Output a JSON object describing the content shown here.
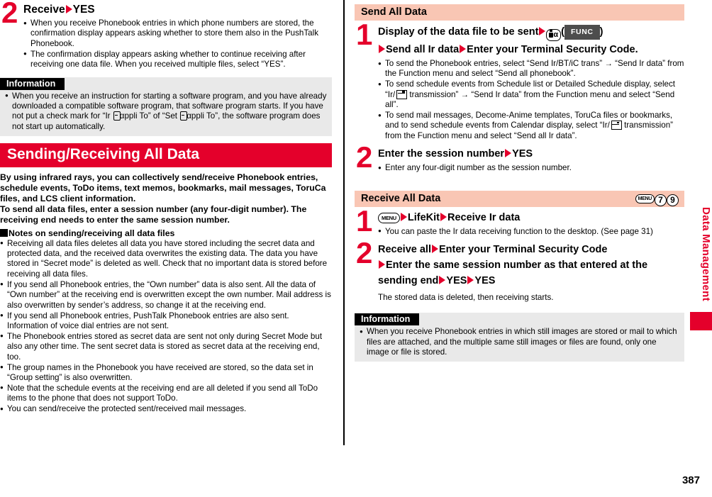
{
  "page": {
    "number": "387",
    "sidebar_label": "Data Management"
  },
  "left_column": {
    "step2": {
      "number": "2",
      "title_a": "Receive",
      "title_b": "YES",
      "bullets": [
        "When you receive Phonebook entries in which phone numbers are stored, the confirmation display appears asking whether to store them also in the PushTalk Phonebook.",
        "The confirmation display appears asking whether to continue receiving after receiving one data file. When you received multiple files, select “YES”."
      ]
    },
    "information": {
      "tag": "Information",
      "text_part1": "When you receive an instruction for starting a software program, and you have already downloaded a compatible software program, that software program starts. If you have not put a check mark for “Ir ",
      "text_part2": "αppli To” of “Set ",
      "text_part3": "αppli To”, the software program does not start up automatically."
    },
    "section": {
      "title": "Sending/Receiving All Data",
      "intro": [
        "By using infrared rays, you can collectively send/receive Phonebook entries, schedule events, ToDo items, text memos, bookmarks, mail messages, ToruCa files, and LCS client information.",
        "To send all data files, enter a session number (any four-digit number). The receiving end needs to enter the same session number."
      ],
      "notes_heading": "Notes on sending/receiving all data files",
      "notes": [
        "Receiving all data files deletes all data you have stored including the secret data and protected data, and the received data overwrites the existing data. The data you have stored in “Secret mode” is deleted as well. Check that no important data is stored before receiving all data files.",
        "If you send all Phonebook entries, the “Own number” data is also sent. All the data of “Own number” at the receiving end is overwritten except the own number. Mail address is also overwritten by sender’s address, so change it at the receiving end.",
        "If you send all Phonebook entries, PushTalk Phonebook entries are also sent. Information of voice dial entries are not sent.",
        "The Phonebook entries stored as secret data are sent not only during Secret Mode but also any other time. The sent secret data is stored as secret data at the receiving end, too.",
        "The group names in the Phonebook you have received are stored, so the data set in “Group setting” is also overwritten.",
        "Note that the schedule events at the receiving end are all deleted if you send all ToDo items to the phone that does not support ToDo.",
        "You can send/receive the protected sent/received mail messages."
      ]
    }
  },
  "right_column": {
    "send_all": {
      "header": "Send All Data",
      "step1": {
        "number": "1",
        "title_a": "Display of the data file to be sent",
        "key_label": "FUNC",
        "title_b": "Send all Ir data",
        "title_c": "Enter your Terminal Security Code.",
        "bullets": {
          "b1": "To send the Phonebook entries, select “Send Ir/BT/iC trans” → “Send Ir data” from the Function menu and select “Send all phonebook”.",
          "b2_part1": "To send schedule events from Schedule list or Detailed Schedule display, select “Ir/",
          "b2_part2": " transmission” → “Send Ir data” from the Function menu and select “Send all”.",
          "b3_part1": "To send mail messages, Decome-Anime templates, ToruCa files or bookmarks, and to send schedule events from Calendar display, select “Ir/",
          "b3_part2": " transmission” from the Function menu and select “Send all Ir data”."
        }
      },
      "step2": {
        "number": "2",
        "title_a": "Enter the session number",
        "title_b": "YES",
        "bullets": [
          "Enter any four-digit number as the session number."
        ]
      }
    },
    "receive_all": {
      "header": "Receive All Data",
      "keys": {
        "menu": "MENU",
        "k1": "7",
        "k2": "9"
      },
      "step1": {
        "number": "1",
        "menu_key": "MENU",
        "title_a": "LifeKit",
        "title_b": "Receive Ir data",
        "bullets": [
          "You can paste the Ir data receiving function to the desktop. (See page 31)"
        ]
      },
      "step2": {
        "number": "2",
        "title_a": "Receive all",
        "title_b": "Enter your Terminal Security Code",
        "title_c": "Enter the same session number as that entered at the",
        "title_d": "sending end",
        "title_e": "YES",
        "title_f": "YES",
        "note": "The stored data is deleted, then receiving starts."
      },
      "information": {
        "tag": "Information",
        "text": "When you receive Phonebook entries in which still images are stored or mail to which files are attached, and the multiple same still images or files are found, only one image or file is stored."
      }
    }
  },
  "colors": {
    "accent_red": "#e4002b",
    "peach": "#f9c6b4",
    "info_gray": "#e9e9e9",
    "func_gray": "#4d4d4d"
  }
}
